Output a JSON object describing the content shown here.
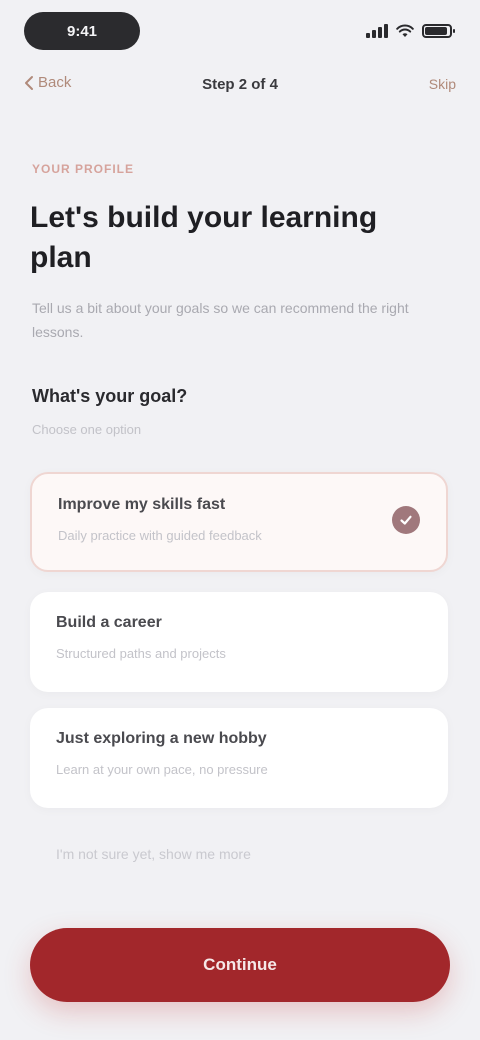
{
  "status_bar": {
    "time": "9:41"
  },
  "nav": {
    "back_label": "Back",
    "title": "Step 2 of 4",
    "step_label": "Skip"
  },
  "intro": {
    "eyebrow": "Your profile",
    "headline": "Let's build your learning plan",
    "subtext": "Tell us a bit about your goals so we can recommend the right lessons."
  },
  "question": {
    "title": "What's your goal?",
    "hint": "Choose one option"
  },
  "options": [
    {
      "title": "Improve my skills fast",
      "desc": "Daily practice with guided feedback",
      "selected": true,
      "icon": "check-icon"
    },
    {
      "title": "Build a career",
      "desc": "Structured paths and projects",
      "selected": false
    },
    {
      "title": "Just exploring a new hobby",
      "desc": "Learn at your own pace, no pressure",
      "selected": false
    },
    {
      "title": "I'm not sure yet, show me more",
      "selected": false
    }
  ],
  "cta": {
    "label": "Continue"
  },
  "colors": {
    "accent": "#a2272b",
    "selected_border": "#efd6d2",
    "background": "#f1f1f4"
  }
}
